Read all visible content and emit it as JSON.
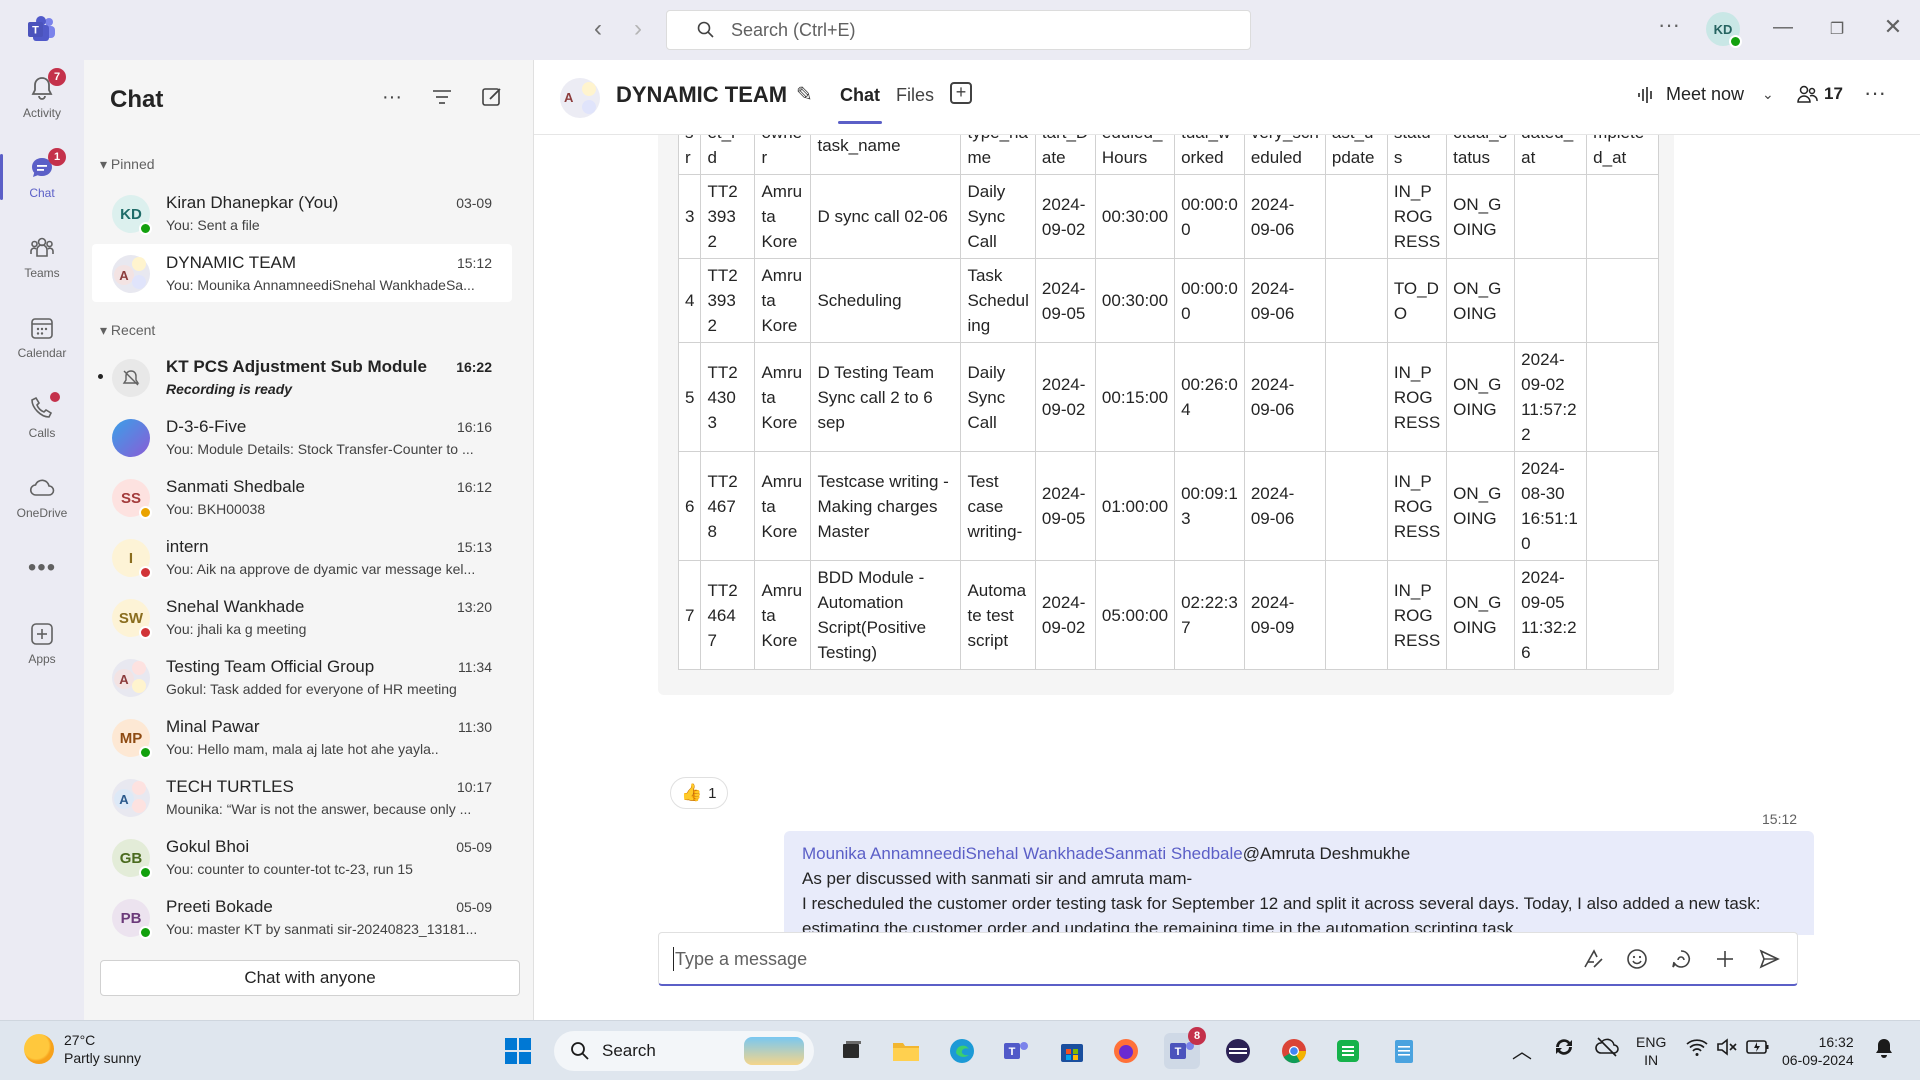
{
  "titlebar": {
    "search_placeholder": "Search (Ctrl+E)",
    "user_initials": "KD",
    "more": "···"
  },
  "rail": [
    {
      "label": "Activity",
      "badge": "7",
      "icon": "bell-icon"
    },
    {
      "label": "Chat",
      "badge": "1",
      "icon": "chat-icon",
      "active": true
    },
    {
      "label": "Teams",
      "icon": "teams-icon"
    },
    {
      "label": "Calendar",
      "icon": "calendar-icon"
    },
    {
      "label": "Calls",
      "icon": "phone-icon"
    },
    {
      "label": "OneDrive",
      "icon": "cloud-icon"
    },
    {
      "label": "Apps",
      "icon": "apps-icon"
    }
  ],
  "chatlist": {
    "title": "Chat",
    "pinned_label": "Pinned",
    "recent_label": "Recent",
    "chat_with_anyone": "Chat with anyone",
    "pinned": [
      {
        "initials": "KD",
        "name": "Kiran Dhanepkar (You)",
        "time": "03-09",
        "preview": "You: Sent a file"
      },
      {
        "initials": "A",
        "name": "DYNAMIC TEAM",
        "time": "15:12",
        "preview": "You: Mounika AnnamneediSnehal WankhadeSa..."
      }
    ],
    "recent": [
      {
        "initials": "",
        "name": "KT PCS Adjustment Sub Module",
        "time": "16:22",
        "preview": "Recording is ready"
      },
      {
        "initials": "",
        "name": "D-3-6-Five",
        "time": "16:16",
        "preview": "You: Module Details: Stock Transfer-Counter to ..."
      },
      {
        "initials": "SS",
        "name": "Sanmati Shedbale",
        "time": "16:12",
        "preview": "You: BKH00038"
      },
      {
        "initials": "I",
        "name": "intern",
        "time": "15:13",
        "preview": "You: Aik na approve de dyamic var message kel..."
      },
      {
        "initials": "SW",
        "name": "Snehal Wankhade",
        "time": "13:20",
        "preview": "You: jhali ka g meeting"
      },
      {
        "initials": "A",
        "name": "Testing Team Official Group",
        "time": "11:34",
        "preview": "Gokul: Task added for everyone of HR meeting"
      },
      {
        "initials": "MP",
        "name": "Minal Pawar",
        "time": "11:30",
        "preview": "You: Hello mam, mala aj late hot ahe yayla.."
      },
      {
        "initials": "A",
        "name": "TECH TURTLES",
        "time": "10:17",
        "preview": "Mounika: “War is not the answer, because only ..."
      },
      {
        "initials": "GB",
        "name": "Gokul Bhoi",
        "time": "05-09",
        "preview": "You: counter to counter-tot tc-23, run 15"
      },
      {
        "initials": "PB",
        "name": "Preeti Bokade",
        "time": "05-09",
        "preview": "You: master KT by sanmati sir-20240823_13181..."
      }
    ]
  },
  "conversation": {
    "title": "DYNAMIC TEAM",
    "tab_chat": "Chat",
    "tab_files": "Files",
    "meet_now": "Meet now",
    "participants": "17",
    "table": {
      "headers": [
        "s\nr",
        "et_i\nd",
        "owne\nr",
        "task_name",
        "type_na\nme",
        "tart_D\nate",
        "eduled_\nHours",
        "tual_w\norked",
        "very_sch\neduled",
        "ast_u\npdate",
        "statu\ns",
        "ctual_s\ntatus",
        "dated_\nat",
        "mplete\nd_at"
      ],
      "rows": [
        [
          "3",
          "TT2\n393\n2",
          "Amru\nta\nKore",
          "D sync call 02-06",
          "Daily\nSync\nCall",
          "2024-\n09-02",
          "00:30:00",
          "00:00:0\n0",
          "2024-\n09-06",
          "",
          "IN_P\nROG\nRESS",
          "ON_G\nOING",
          "",
          ""
        ],
        [
          "4",
          "TT2\n393\n2",
          "Amru\nta\nKore",
          "Scheduling",
          "Task\nSchedul\ning",
          "2024-\n09-05",
          "00:30:00",
          "00:00:0\n0",
          "2024-\n09-06",
          "",
          "TO_D\nO",
          "ON_G\nOING",
          "",
          ""
        ],
        [
          "5",
          "TT2\n430\n3",
          "Amru\nta\nKore",
          "D Testing Team\nSync call 2 to 6\nsep",
          "Daily\nSync\nCall",
          "2024-\n09-02",
          "00:15:00",
          "00:26:0\n4",
          "2024-\n09-06",
          "",
          "IN_P\nROG\nRESS",
          "ON_G\nOING",
          "2024-\n09-02\n11:57:2\n2",
          ""
        ],
        [
          "6",
          "TT2\n467\n8",
          "Amru\nta\nKore",
          "Testcase writing -\nMaking charges\nMaster",
          "Test\ncase\nwriting-",
          "2024-\n09-05",
          "01:00:00",
          "00:09:1\n3",
          "2024-\n09-06",
          "",
          "IN_P\nROG\nRESS",
          "ON_G\nOING",
          "2024-\n08-30\n16:51:1\n0",
          ""
        ],
        [
          "7",
          "TT2\n464\n7",
          "Amru\nta\nKore",
          "BDD Module -\nAutomation\nScript(Positive\nTesting)",
          "Automa\nte test\nscript",
          "2024-\n09-02",
          "05:00:00",
          "02:22:3\n7",
          "2024-\n09-09",
          "",
          "IN_P\nROG\nRESS",
          "ON_G\nOING",
          "2024-\n09-05\n11:32:2\n6",
          ""
        ]
      ]
    },
    "reaction_count": "1",
    "message": {
      "time": "15:12",
      "mentions": "Mounika AnnamneediSnehal WankhadeSanmati Shedbale",
      "mention_tail": "@Amruta Deshmukhe",
      "line1": "As per discussed with sanmati sir and amruta mam-",
      "line2": "I rescheduled the customer order testing task for September 12 and split it across several days. Today, I also added a new task: estimating the customer order and updating the remaining time in the automation scripting task."
    },
    "composer_placeholder": "Type a message"
  },
  "taskbar": {
    "temperature": "27°C",
    "weather": "Partly sunny",
    "search": "Search",
    "teams_badge": "8",
    "lang1": "ENG",
    "lang2": "IN",
    "time": "16:32",
    "date": "06-09-2024"
  }
}
